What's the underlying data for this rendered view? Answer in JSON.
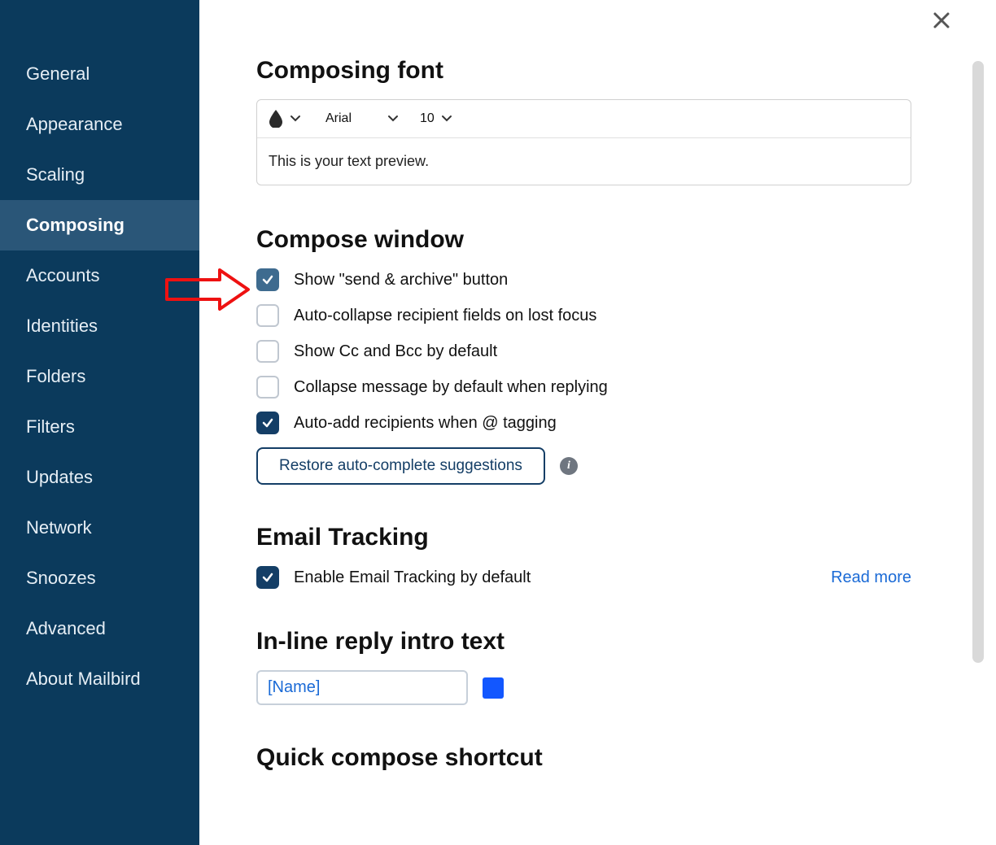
{
  "sidebar": {
    "items": [
      {
        "label": "General"
      },
      {
        "label": "Appearance"
      },
      {
        "label": "Scaling"
      },
      {
        "label": "Composing",
        "active": true
      },
      {
        "label": "Accounts"
      },
      {
        "label": "Identities"
      },
      {
        "label": "Folders"
      },
      {
        "label": "Filters"
      },
      {
        "label": "Updates"
      },
      {
        "label": "Network"
      },
      {
        "label": "Snoozes"
      },
      {
        "label": "Advanced"
      },
      {
        "label": "About Mailbird"
      }
    ]
  },
  "sections": {
    "composing_font": {
      "title": "Composing font",
      "font_name": "Arial",
      "font_size": "10",
      "preview_text": "This is your text preview."
    },
    "compose_window": {
      "title": "Compose window",
      "options": [
        {
          "label": "Show \"send & archive\" button",
          "checked": true,
          "highlight": true
        },
        {
          "label": "Auto-collapse recipient fields on lost focus",
          "checked": false
        },
        {
          "label": "Show Cc and Bcc by default",
          "checked": false
        },
        {
          "label": "Collapse message by default when replying",
          "checked": false
        },
        {
          "label": "Auto-add recipients when @ tagging",
          "checked": true
        }
      ],
      "restore_button": "Restore auto-complete suggestions"
    },
    "email_tracking": {
      "title": "Email Tracking",
      "option_label": "Enable Email Tracking by default",
      "option_checked": true,
      "link": "Read more"
    },
    "inline_reply": {
      "title": "In-line reply intro text",
      "value": "[Name]",
      "color": "#1257ff"
    },
    "quick_compose": {
      "title": "Quick compose shortcut"
    }
  },
  "info_glyph": "i"
}
